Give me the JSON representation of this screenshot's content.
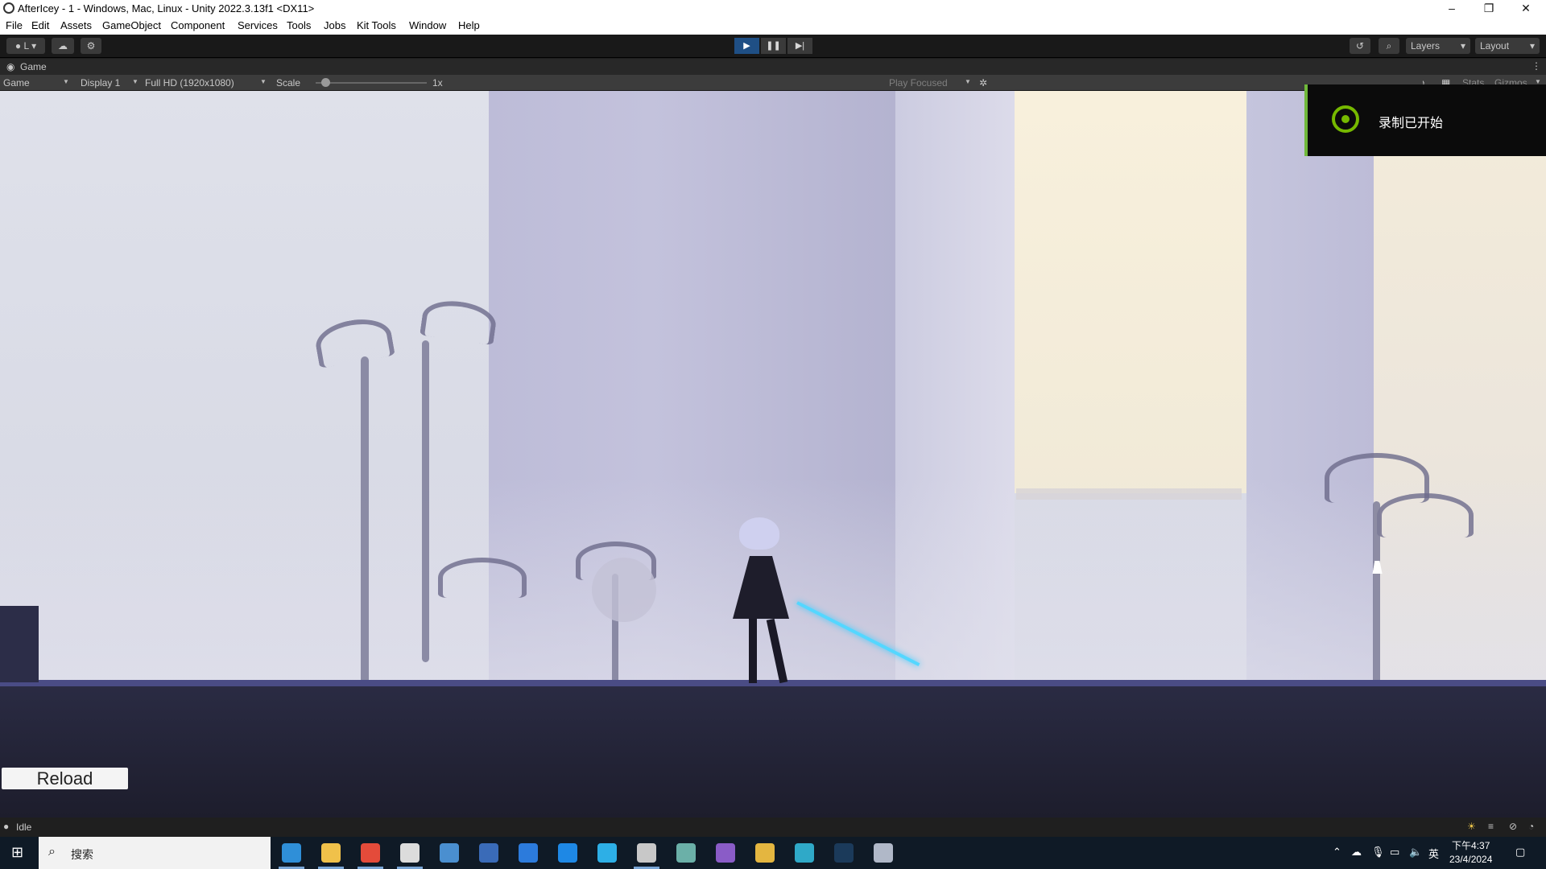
{
  "window": {
    "title": "AfterIcey - 1 - Windows, Mac, Linux - Unity 2022.3.13f1 <DX11>",
    "controls": [
      "–",
      "❐",
      "✕"
    ]
  },
  "menu": [
    "File",
    "Edit",
    "Assets",
    "GameObject",
    "Component",
    "Services",
    "Tools",
    "Jobs",
    "Kit Tools",
    "Window",
    "Help"
  ],
  "toolbar": {
    "account_label": "L",
    "layers_label": "Layers",
    "layout_label": "Layout",
    "play_icon": "play-icon",
    "pause_icon": "pause-icon",
    "step_icon": "step-icon"
  },
  "game_tab": {
    "title": "Game"
  },
  "game_bar": {
    "view_mode": "Game",
    "display": "Display 1",
    "resolution": "Full HD (1920x1080)",
    "scale_label": "Scale",
    "scale_value": "1x",
    "scale_fraction": 0.0,
    "play_mode": "Play Focused",
    "stats_label": "Stats",
    "gizmos_label": "Gizmos"
  },
  "game_view": {
    "reload_label": "Reload",
    "notification_text": "录制已开始",
    "accent_color": "#76b900"
  },
  "status": {
    "text": "Idle"
  },
  "taskbar": {
    "search_placeholder": "搜索",
    "ime": "英",
    "time": "下午4:37",
    "date": "23/4/2024",
    "apps": [
      "edge-icon",
      "file-explorer-icon",
      "chrome-icon",
      "unity-hub-icon",
      "remote-desktop-icon",
      "vscode-like-icon",
      "app-store-icon",
      "maps-icon",
      "bluesky-icon",
      "unity-icon",
      "notes-icon",
      "visual-studio-icon",
      "game-icon",
      "m-app-icon",
      "steam-icon",
      "app-icon"
    ]
  }
}
